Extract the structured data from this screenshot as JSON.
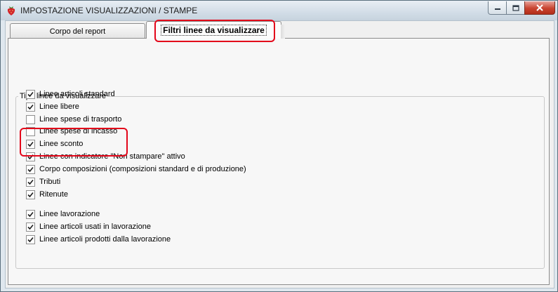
{
  "window": {
    "title": "IMPOSTAZIONE VISUALIZZAZIONI / STAMPE"
  },
  "tabs": [
    {
      "label": "Corpo del report",
      "selected": false
    },
    {
      "label": "Filtri linee da visualizzare",
      "selected": true
    }
  ],
  "group": {
    "title": "Tipo linee da visualizzare",
    "items": [
      {
        "label": "Linee articoli standard",
        "checked": true
      },
      {
        "label": "Linee libere",
        "checked": true
      },
      {
        "label": "Linee spese di trasporto",
        "checked": false
      },
      {
        "label": "Linee spese di incasso",
        "checked": false
      },
      {
        "label": "Linee sconto",
        "checked": true
      },
      {
        "label": "Linee con indicatore \"Non stampare\" attivo",
        "checked": true
      },
      {
        "label": "Corpo composizioni (composizioni standard e di produzione)",
        "checked": true
      },
      {
        "label": "Tributi",
        "checked": true
      },
      {
        "label": "Ritenute",
        "checked": true
      },
      {
        "label": "Linee lavorazione",
        "checked": true
      },
      {
        "label": "Linee articoli usati in lavorazione",
        "checked": true
      },
      {
        "label": "Linee articoli prodotti dalla lavorazione",
        "checked": true
      }
    ]
  },
  "colors": {
    "highlight": "#e3061a",
    "close_button": "#c8432f"
  },
  "icons": {
    "app": "strawberry-icon",
    "minimize": "minimize-icon",
    "maximize": "maximize-icon",
    "close": "close-icon"
  }
}
